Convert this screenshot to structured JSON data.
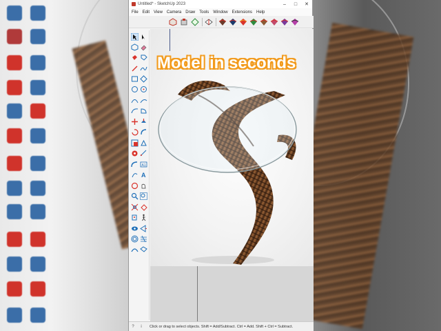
{
  "window": {
    "title": "Untitled* - SketchUp 2023",
    "controls": {
      "minimize": "–",
      "maximize": "□",
      "close": "✕"
    }
  },
  "menu": {
    "items": [
      "File",
      "Edit",
      "View",
      "Camera",
      "Draw",
      "Tools",
      "Window",
      "Extensions",
      "Help"
    ]
  },
  "overlay": {
    "headline": "Model in seconds",
    "headline_color": "#ffffff",
    "headline_outline": "#f29b1d"
  },
  "status": {
    "icons": [
      "?",
      "i"
    ],
    "message": "Click or drag to select objects. Shift = Add/Subtract. Ctrl = Add. Shift + Ctrl = Subtract."
  },
  "toolbar_icons": [
    "warehouse-icon",
    "extension-warehouse-icon",
    "3d-text-icon",
    "layout-icon",
    "material-icon",
    "style-red-icon",
    "style-blue-icon",
    "style-orange-icon",
    "style-green-icon",
    "style-brown-icon",
    "style-pink-icon",
    "style-purple-icon"
  ],
  "colors": {
    "accent": "#1e73be",
    "tool_red": "#d9332b",
    "tool_blue": "#1e6fb8"
  }
}
